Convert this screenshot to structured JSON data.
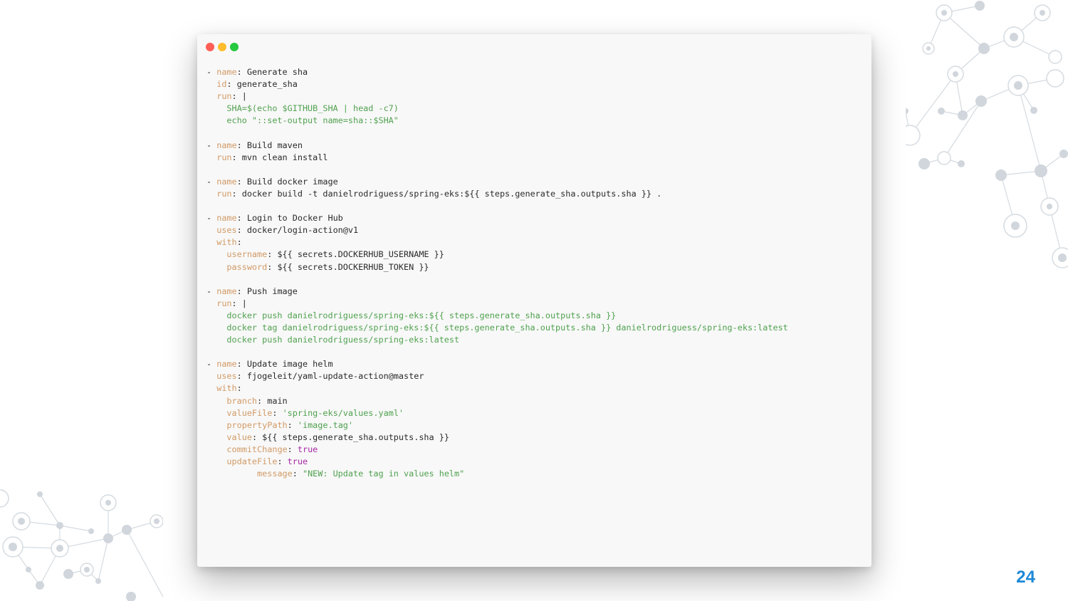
{
  "slide": {
    "page_number": "24",
    "colors": {
      "page_number": "#1e88d6",
      "key": "#d19a66",
      "string": "#50a14f",
      "boolean": "#a626a4"
    }
  },
  "window": {
    "controls": [
      "close",
      "minimize",
      "maximize"
    ],
    "code_lines": [
      [
        {
          "t": "- ",
          "c": ""
        },
        {
          "t": "name",
          "c": "k"
        },
        {
          "t": ": Generate sha",
          "c": ""
        }
      ],
      [
        {
          "t": "  ",
          "c": ""
        },
        {
          "t": "id",
          "c": "k"
        },
        {
          "t": ": generate_sha",
          "c": ""
        }
      ],
      [
        {
          "t": "  ",
          "c": ""
        },
        {
          "t": "run",
          "c": "k"
        },
        {
          "t": ": |",
          "c": ""
        }
      ],
      [
        {
          "t": "    SHA=$(echo $GITHUB_SHA | head -c7)",
          "c": "s"
        }
      ],
      [
        {
          "t": "    echo \"::set-output name=sha::$SHA\"",
          "c": "s"
        }
      ],
      [],
      [
        {
          "t": "- ",
          "c": ""
        },
        {
          "t": "name",
          "c": "k"
        },
        {
          "t": ": Build maven",
          "c": ""
        }
      ],
      [
        {
          "t": "  ",
          "c": ""
        },
        {
          "t": "run",
          "c": "k"
        },
        {
          "t": ": mvn clean install",
          "c": ""
        }
      ],
      [],
      [
        {
          "t": "- ",
          "c": ""
        },
        {
          "t": "name",
          "c": "k"
        },
        {
          "t": ": Build docker image",
          "c": ""
        }
      ],
      [
        {
          "t": "  ",
          "c": ""
        },
        {
          "t": "run",
          "c": "k"
        },
        {
          "t": ": docker build -t danielrodriguess/spring-eks:${{ steps.generate_sha.outputs.sha }} .",
          "c": ""
        }
      ],
      [],
      [
        {
          "t": "- ",
          "c": ""
        },
        {
          "t": "name",
          "c": "k"
        },
        {
          "t": ": Login to Docker Hub",
          "c": ""
        }
      ],
      [
        {
          "t": "  ",
          "c": ""
        },
        {
          "t": "uses",
          "c": "k"
        },
        {
          "t": ": docker/login-action@v1",
          "c": ""
        }
      ],
      [
        {
          "t": "  ",
          "c": ""
        },
        {
          "t": "with",
          "c": "k"
        },
        {
          "t": ":",
          "c": ""
        }
      ],
      [
        {
          "t": "    ",
          "c": ""
        },
        {
          "t": "username",
          "c": "k"
        },
        {
          "t": ": ${{ secrets.DOCKERHUB_USERNAME }}",
          "c": ""
        }
      ],
      [
        {
          "t": "    ",
          "c": ""
        },
        {
          "t": "password",
          "c": "k"
        },
        {
          "t": ": ${{ secrets.DOCKERHUB_TOKEN }}",
          "c": ""
        }
      ],
      [],
      [
        {
          "t": "- ",
          "c": ""
        },
        {
          "t": "name",
          "c": "k"
        },
        {
          "t": ": Push image",
          "c": ""
        }
      ],
      [
        {
          "t": "  ",
          "c": ""
        },
        {
          "t": "run",
          "c": "k"
        },
        {
          "t": ": |",
          "c": ""
        }
      ],
      [
        {
          "t": "    docker push danielrodriguess/spring-eks:${{ steps.generate_sha.outputs.sha }}",
          "c": "s"
        }
      ],
      [
        {
          "t": "    docker tag danielrodriguess/spring-eks:${{ steps.generate_sha.outputs.sha }} danielrodriguess/spring-eks:latest",
          "c": "s"
        }
      ],
      [
        {
          "t": "    docker push danielrodriguess/spring-eks:latest",
          "c": "s"
        }
      ],
      [],
      [
        {
          "t": "- ",
          "c": ""
        },
        {
          "t": "name",
          "c": "k"
        },
        {
          "t": ": Update image helm",
          "c": ""
        }
      ],
      [
        {
          "t": "  ",
          "c": ""
        },
        {
          "t": "uses",
          "c": "k"
        },
        {
          "t": ": fjogeleit/yaml-update-action@master",
          "c": ""
        }
      ],
      [
        {
          "t": "  ",
          "c": ""
        },
        {
          "t": "with",
          "c": "k"
        },
        {
          "t": ":",
          "c": ""
        }
      ],
      [
        {
          "t": "    ",
          "c": ""
        },
        {
          "t": "branch",
          "c": "k"
        },
        {
          "t": ": main",
          "c": ""
        }
      ],
      [
        {
          "t": "    ",
          "c": ""
        },
        {
          "t": "valueFile",
          "c": "k"
        },
        {
          "t": ": ",
          "c": ""
        },
        {
          "t": "'spring-eks/values.yaml'",
          "c": "s"
        }
      ],
      [
        {
          "t": "    ",
          "c": ""
        },
        {
          "t": "propertyPath",
          "c": "k"
        },
        {
          "t": ": ",
          "c": ""
        },
        {
          "t": "'image.tag'",
          "c": "s"
        }
      ],
      [
        {
          "t": "    ",
          "c": ""
        },
        {
          "t": "value",
          "c": "k"
        },
        {
          "t": ": ${{ steps.generate_sha.outputs.sha }}",
          "c": ""
        }
      ],
      [
        {
          "t": "    ",
          "c": ""
        },
        {
          "t": "commitChange",
          "c": "k"
        },
        {
          "t": ": ",
          "c": ""
        },
        {
          "t": "true",
          "c": "b"
        }
      ],
      [
        {
          "t": "    ",
          "c": ""
        },
        {
          "t": "updateFile",
          "c": "k"
        },
        {
          "t": ": ",
          "c": ""
        },
        {
          "t": "true",
          "c": "b"
        }
      ],
      [
        {
          "t": "          ",
          "c": ""
        },
        {
          "t": "message",
          "c": "k"
        },
        {
          "t": ": ",
          "c": ""
        },
        {
          "t": "\"NEW: Update tag in values helm\"",
          "c": "s"
        }
      ]
    ]
  }
}
